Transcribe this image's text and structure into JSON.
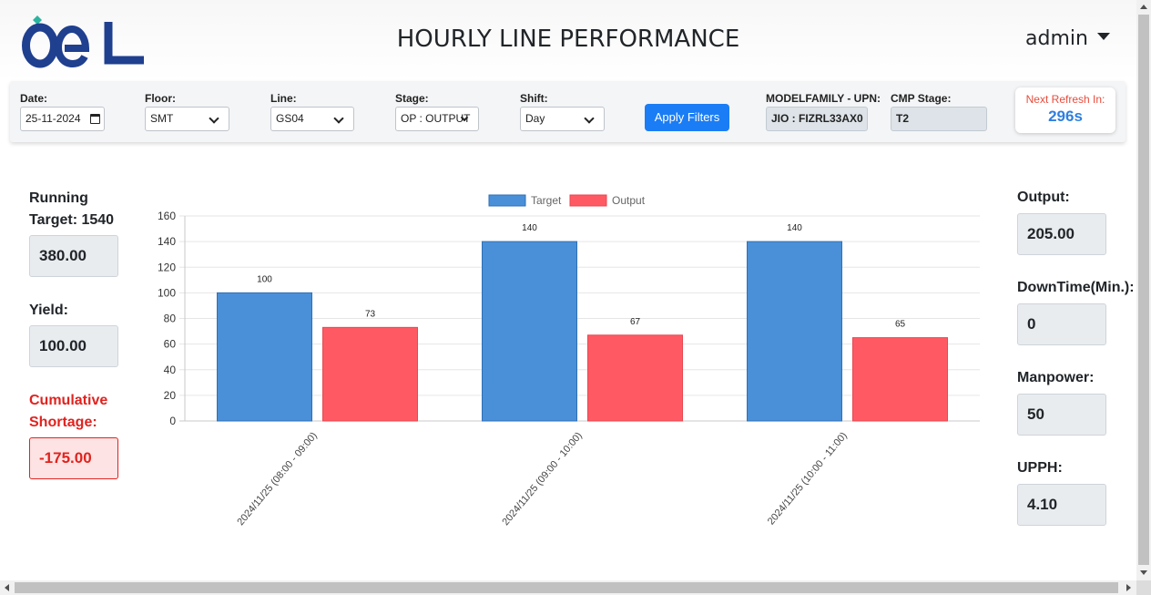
{
  "header": {
    "title": "HOURLY LINE PERFORMANCE",
    "user": "admin",
    "logo_text": "OEL"
  },
  "filters": {
    "date": {
      "label": "Date:",
      "value": "25-11-2024"
    },
    "floor": {
      "label": "Floor:",
      "value": "SMT"
    },
    "line": {
      "label": "Line:",
      "value": "GS04"
    },
    "stage": {
      "label": "Stage:",
      "value": "OP : OUTPUT"
    },
    "shift": {
      "label": "Shift:",
      "value": "Day"
    },
    "apply_label": "Apply Filters",
    "modelfamily": {
      "label": "MODELFAMILY - UPN:",
      "value": "JIO : FIZRL33AX0"
    },
    "cmp_stage": {
      "label": "CMP Stage:",
      "value": "T2"
    },
    "refresh": {
      "label": "Next Refresh In:",
      "value": "296s"
    }
  },
  "left_metrics": {
    "running_target": {
      "label_line1": "Running",
      "label_line2": "Target: 1540",
      "value": "380.00"
    },
    "yield": {
      "label": "Yield:",
      "value": "100.00"
    },
    "cumulative_shortage": {
      "label_line1": "Cumulative",
      "label_line2": "Shortage:",
      "value": "-175.00"
    }
  },
  "right_metrics": {
    "output": {
      "label": "Output:",
      "value": "205.00"
    },
    "downtime": {
      "label": "DownTime(Min.):",
      "value": "0"
    },
    "manpower": {
      "label": "Manpower:",
      "value": "50"
    },
    "upph": {
      "label": "UPPH:",
      "value": "4.10"
    }
  },
  "colors": {
    "target": "#4a90d9",
    "output": "#ff5a64",
    "alert": "#e0231f",
    "accent": "#1a7df5"
  },
  "chart_data": {
    "type": "bar",
    "categories": [
      "2024/11/25 (08:00 - 09:00)",
      "2024/11/25 (09:00 - 10:00)",
      "2024/11/25 (10:00 - 11:00)"
    ],
    "series": [
      {
        "name": "Target",
        "values": [
          100,
          140,
          140
        ]
      },
      {
        "name": "Output",
        "values": [
          73,
          67,
          65
        ]
      }
    ],
    "ylim": [
      0,
      160
    ],
    "yticks": [
      0,
      20,
      40,
      60,
      80,
      100,
      120,
      140,
      160
    ],
    "legend": "top-center",
    "grid": true
  }
}
